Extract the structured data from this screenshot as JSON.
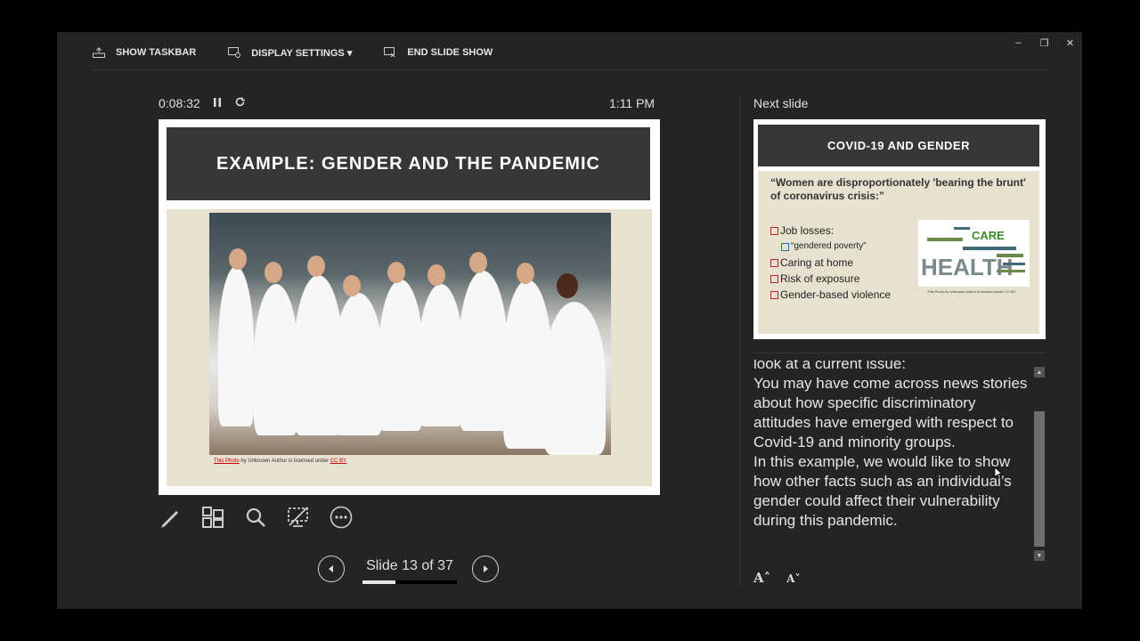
{
  "toolbar": {
    "show_taskbar": "SHOW TASKBAR",
    "display_settings": "DISPLAY SETTINGS ▾",
    "end_slide_show": "END SLIDE SHOW"
  },
  "window_controls": {
    "minimize": "–",
    "restore": "❐",
    "close": "✕"
  },
  "timer": {
    "elapsed": "0:08:32",
    "clock": "1:11 PM"
  },
  "current_slide": {
    "title": "EXAMPLE: GENDER AND THE PANDEMIC",
    "credit_link": "This Photo",
    "credit_text": " by Unknown Author is licensed under ",
    "credit_license": "CC BY"
  },
  "navigation": {
    "slide_label": "Slide 13 of 37",
    "progress_fraction": 0.351
  },
  "next_slide": {
    "label": "Next slide",
    "title": "COVID-19 AND GENDER",
    "quote": "“Women are disproportionately 'bearing the brunt' of coronavirus crisis:”",
    "items": [
      {
        "text": "Job losses:"
      },
      {
        "text": "“gendered poverty”",
        "sub": true
      },
      {
        "text": "Caring at home"
      },
      {
        "text": "Risk of exposure"
      },
      {
        "text": "Gender-based violence"
      }
    ],
    "wordcloud": {
      "word1": "CARE",
      "word2": "HEALTH"
    },
    "wc_credit": "This Photo by Unknown Author is licensed under CC BY"
  },
  "notes": {
    "lines": [
      "look at a current issue:",
      "You may have come across news stories about how specific discriminatory attitudes have emerged with respect to Covid-19 and minority groups.",
      "In this example, we would like to show how other facts such as an individual’s gender could affect their vulnerability during this pandemic."
    ]
  },
  "font_buttons": {
    "increase": "A˄",
    "decrease": "A˅"
  }
}
